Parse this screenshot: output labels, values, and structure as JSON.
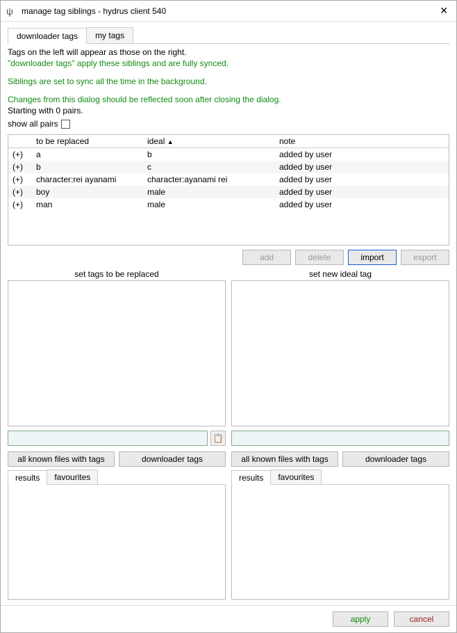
{
  "window": {
    "title": "manage tag siblings - hydrus client 540"
  },
  "tabs": [
    {
      "label": "downloader tags",
      "active": true
    },
    {
      "label": "my tags",
      "active": false
    }
  ],
  "info": {
    "line1": "Tags on the left will appear as those on the right.",
    "line2_green": "\"downloader tags\" apply these siblings and are fully synced.",
    "line3_green": "Siblings are set to sync all the time in the background.",
    "line4_green": "Changes from this dialog should be reflected soon after closing the dialog.",
    "line5": "Starting with 0 pairs.",
    "show_all_label": "show all pairs"
  },
  "table": {
    "headers": {
      "sel": "",
      "replace": "to be replaced",
      "ideal": "ideal",
      "note": "note"
    },
    "sort_indicator": "▲",
    "rows": [
      {
        "sel": "(+)",
        "replace": "a",
        "ideal": "b",
        "note": "added by user"
      },
      {
        "sel": "(+)",
        "replace": "b",
        "ideal": "c",
        "note": "added by user"
      },
      {
        "sel": "(+)",
        "replace": "character:rei ayanami",
        "ideal": "character:ayanami rei",
        "note": "added by user"
      },
      {
        "sel": "(+)",
        "replace": "boy",
        "ideal": "male",
        "note": "added by user"
      },
      {
        "sel": "(+)",
        "replace": "man",
        "ideal": "male",
        "note": "added by user"
      }
    ]
  },
  "buttons_row": {
    "add": "add",
    "delete": "delete",
    "import": "import",
    "export": "export"
  },
  "panels": {
    "left_label": "set tags to be replaced",
    "right_label": "set new ideal tag",
    "paste_icon": "📋",
    "filter_all": "all known files with tags",
    "filter_service": "downloader tags",
    "subtab_results": "results",
    "subtab_favourites": "favourites"
  },
  "footer": {
    "apply": "apply",
    "cancel": "cancel"
  }
}
